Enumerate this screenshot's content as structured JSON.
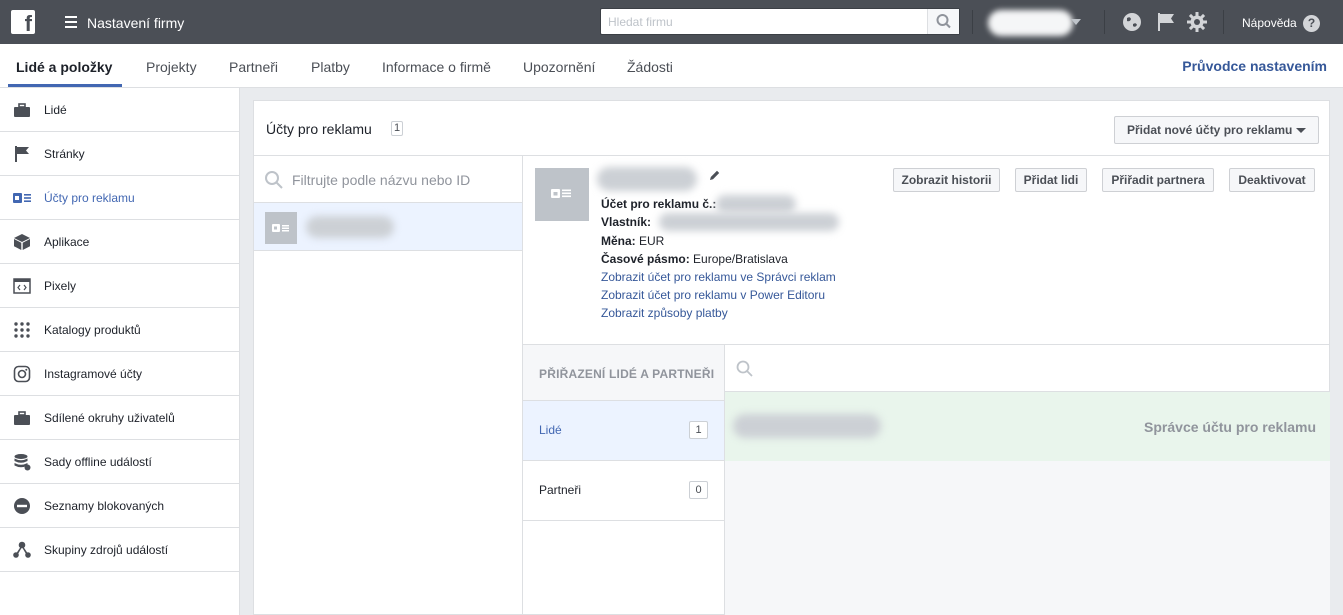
{
  "topbar": {
    "app_title": "Nastavení firmy",
    "search_placeholder": "Hledat firmu",
    "help_label": "Nápověda",
    "help_glyph": "?",
    "logo_glyph": "f"
  },
  "tabs": {
    "items": [
      "Lidé a položky",
      "Projekty",
      "Partneři",
      "Platby",
      "Informace o firmě",
      "Upozornění",
      "Žádosti"
    ],
    "active_index": 0,
    "guide_link": "Průvodce nastavením"
  },
  "sidebar": {
    "items": [
      {
        "label": "Lidé",
        "icon": "briefcase-icon"
      },
      {
        "label": "Stránky",
        "icon": "flag-icon"
      },
      {
        "label": "Účty pro reklamu",
        "icon": "ad-account-icon"
      },
      {
        "label": "Aplikace",
        "icon": "cube-icon"
      },
      {
        "label": "Pixely",
        "icon": "code-icon"
      },
      {
        "label": "Katalogy produktů",
        "icon": "grid-icon"
      },
      {
        "label": "Instagramové účty",
        "icon": "instagram-icon"
      },
      {
        "label": "Sdílené okruhy uživatelů",
        "icon": "briefcase-icon"
      },
      {
        "label": "Sady offline událostí",
        "icon": "database-icon"
      },
      {
        "label": "Seznamy blokovaných",
        "icon": "block-icon"
      },
      {
        "label": "Skupiny zdrojů událostí",
        "icon": "network-icon"
      }
    ],
    "active_index": 2
  },
  "main": {
    "title": "Účty pro reklamu",
    "title_count": "1",
    "add_button": "Přidat nové účty pro reklamu",
    "filter_placeholder": "Filtrujte podle názvu nebo ID",
    "actions": {
      "history": "Zobrazit historii",
      "add_people": "Přidat lidi",
      "assign_partner": "Přiřadit partnera",
      "deactivate": "Deaktivovat"
    },
    "details": {
      "account_no_label": "Účet pro reklamu č.:",
      "owner_label": "Vlastník:",
      "currency_label": "Měna:",
      "currency_value": "EUR",
      "timezone_label": "Časové pásmo:",
      "timezone_value": "Europe/Bratislava"
    },
    "links": [
      "Zobrazit účet pro reklamu ve Správci reklam",
      "Zobrazit účet pro reklamu v Power Editoru",
      "Zobrazit způsoby platby"
    ],
    "assign": {
      "heading": "PŘIŘAZENÍ LIDÉ A PARTNEŘI",
      "people_label": "Lidé",
      "people_count": "1",
      "partners_label": "Partneři",
      "partners_count": "0"
    },
    "person_role": "Správce účtu pro reklamu"
  },
  "colors": {
    "topbar_bg": "#4b4f56",
    "accent_blue": "#4267b2",
    "link_blue": "#365899",
    "selected_bg": "#ecf3ff",
    "person_row_bg": "#e9f5ec"
  }
}
